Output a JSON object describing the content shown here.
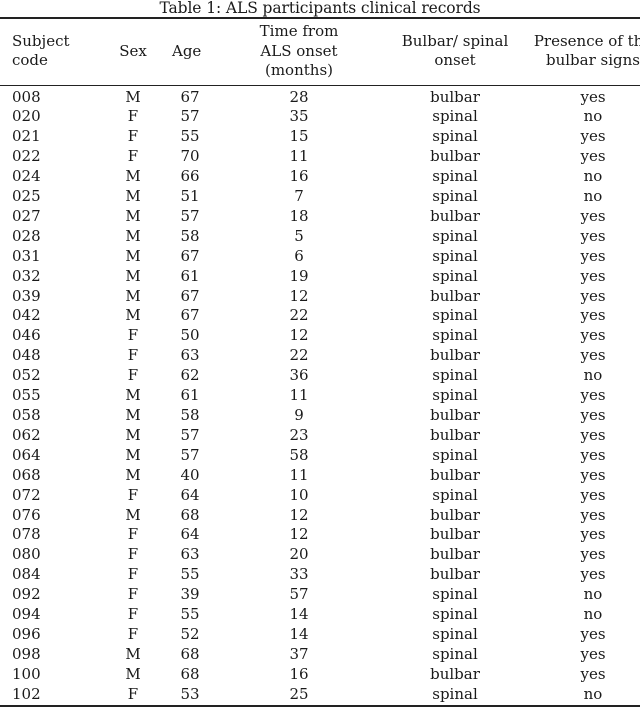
{
  "caption": "Table 1: ALS participants clinical records",
  "columns": [
    {
      "label_lines": [
        "Subject",
        "code"
      ]
    },
    {
      "label_lines": [
        "Sex"
      ]
    },
    {
      "label_lines": [
        "Age"
      ]
    },
    {
      "label_lines": [
        "Time from",
        "ALS onset",
        "(months)"
      ]
    },
    {
      "label_lines": [
        "Bulbar/ spinal",
        "onset"
      ]
    },
    {
      "label_lines": [
        "Presence of the",
        "bulbar signs"
      ]
    }
  ],
  "rows": [
    [
      "008",
      "M",
      "67",
      "28",
      "bulbar",
      "yes"
    ],
    [
      "020",
      "F",
      "57",
      "35",
      "spinal",
      "no"
    ],
    [
      "021",
      "F",
      "55",
      "15",
      "spinal",
      "yes"
    ],
    [
      "022",
      "F",
      "70",
      "11",
      "bulbar",
      "yes"
    ],
    [
      "024",
      "M",
      "66",
      "16",
      "spinal",
      "no"
    ],
    [
      "025",
      "M",
      "51",
      "7",
      "spinal",
      "no"
    ],
    [
      "027",
      "M",
      "57",
      "18",
      "bulbar",
      "yes"
    ],
    [
      "028",
      "M",
      "58",
      "5",
      "spinal",
      "yes"
    ],
    [
      "031",
      "M",
      "67",
      "6",
      "spinal",
      "yes"
    ],
    [
      "032",
      "M",
      "61",
      "19",
      "spinal",
      "yes"
    ],
    [
      "039",
      "M",
      "67",
      "12",
      "bulbar",
      "yes"
    ],
    [
      "042",
      "M",
      "67",
      "22",
      "spinal",
      "yes"
    ],
    [
      "046",
      "F",
      "50",
      "12",
      "spinal",
      "yes"
    ],
    [
      "048",
      "F",
      "63",
      "22",
      "bulbar",
      "yes"
    ],
    [
      "052",
      "F",
      "62",
      "36",
      "spinal",
      "no"
    ],
    [
      "055",
      "M",
      "61",
      "11",
      "spinal",
      "yes"
    ],
    [
      "058",
      "M",
      "58",
      "9",
      "bulbar",
      "yes"
    ],
    [
      "062",
      "M",
      "57",
      "23",
      "bulbar",
      "yes"
    ],
    [
      "064",
      "M",
      "57",
      "58",
      "spinal",
      "yes"
    ],
    [
      "068",
      "M",
      "40",
      "11",
      "bulbar",
      "yes"
    ],
    [
      "072",
      "F",
      "64",
      "10",
      "spinal",
      "yes"
    ],
    [
      "076",
      "M",
      "68",
      "12",
      "bulbar",
      "yes"
    ],
    [
      "078",
      "F",
      "64",
      "12",
      "bulbar",
      "yes"
    ],
    [
      "080",
      "F",
      "63",
      "20",
      "bulbar",
      "yes"
    ],
    [
      "084",
      "F",
      "55",
      "33",
      "bulbar",
      "yes"
    ],
    [
      "092",
      "F",
      "39",
      "57",
      "spinal",
      "no"
    ],
    [
      "094",
      "F",
      "55",
      "14",
      "spinal",
      "no"
    ],
    [
      "096",
      "F",
      "52",
      "14",
      "spinal",
      "yes"
    ],
    [
      "098",
      "M",
      "68",
      "37",
      "spinal",
      "yes"
    ],
    [
      "100",
      "M",
      "68",
      "16",
      "bulbar",
      "yes"
    ],
    [
      "102",
      "F",
      "53",
      "25",
      "spinal",
      "no"
    ]
  ]
}
